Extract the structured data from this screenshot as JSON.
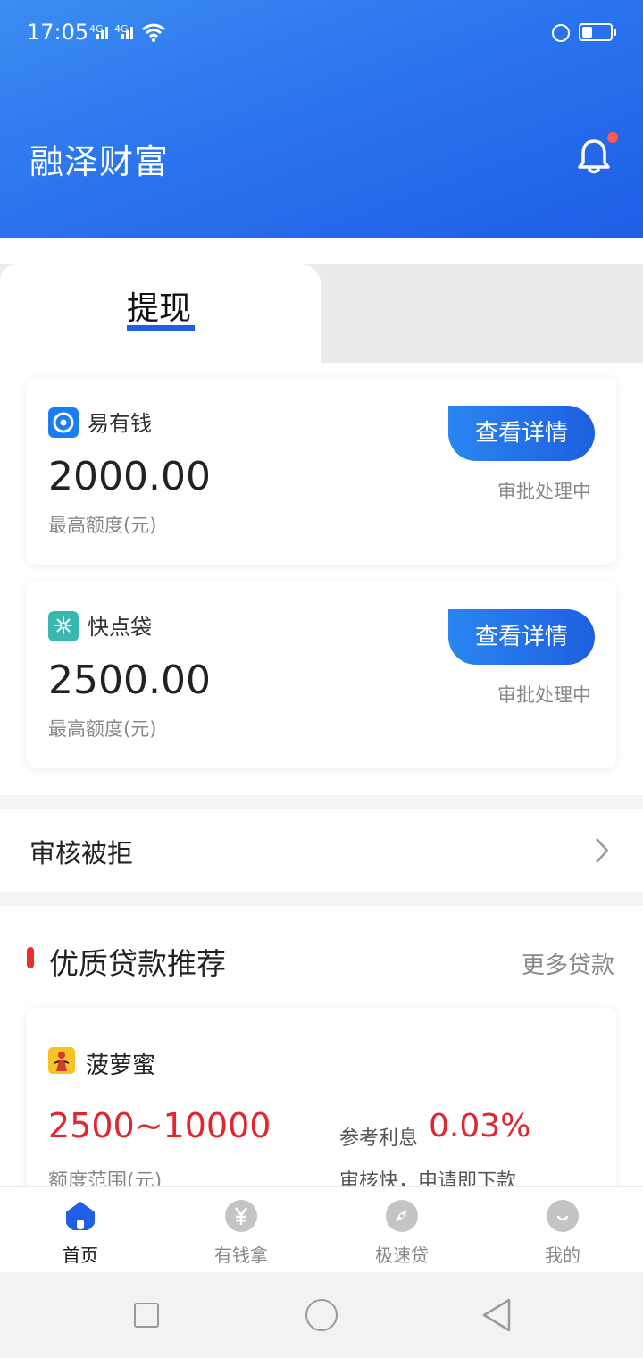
{
  "status_bar": {
    "time": "17:05",
    "network1": "4G",
    "network2": "4G",
    "battery_level": 0.35
  },
  "header": {
    "title": "融泽财富",
    "notification_icon": "bell-icon",
    "has_unread": true
  },
  "tabs": {
    "active_label": "提现"
  },
  "cards": [
    {
      "name": "易有钱",
      "amount": "2000.00",
      "amount_label": "最高额度(元)",
      "button": "查看详情",
      "status": "审批处理中",
      "logo": "yiyouqian-logo"
    },
    {
      "name": "快点袋",
      "amount": "2500.00",
      "amount_label": "最高额度(元)",
      "button": "查看详情",
      "status": "审批处理中",
      "logo": "kuaidiandai-logo"
    }
  ],
  "rejected": {
    "label": "审核被拒"
  },
  "recommend": {
    "title": "优质贷款推荐",
    "more": "更多贷款",
    "item": {
      "name": "菠萝蜜",
      "range": "2500~10000",
      "range_label": "额度范围(元)",
      "rate_label": "参考利息",
      "rate_value": "0.03%",
      "desc": "审核快，申请即下款"
    }
  },
  "tabbar": [
    {
      "label": "首页",
      "icon": "home-icon",
      "active": true
    },
    {
      "label": "有钱拿",
      "icon": "yuan-icon",
      "active": false
    },
    {
      "label": "极速贷",
      "icon": "compass-icon",
      "active": false
    },
    {
      "label": "我的",
      "icon": "smile-icon",
      "active": false
    }
  ],
  "colors": {
    "primary": "#1f5fe6",
    "accent_red": "#e0262f",
    "header_start": "#3a8df0"
  }
}
